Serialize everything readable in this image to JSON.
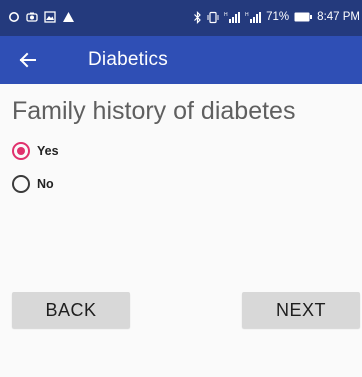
{
  "status_bar": {
    "battery_percent": "71%",
    "time": "8:47 PM",
    "icons": [
      "location-pin-icon",
      "camera-icon",
      "image-icon",
      "warning-icon",
      "bluetooth-icon",
      "vibrate-icon",
      "signal-1-icon",
      "signal-2-icon",
      "battery-icon"
    ]
  },
  "app_bar": {
    "title": "Diabetics",
    "back_icon": "back-arrow-icon"
  },
  "question": {
    "text": "Family history of diabetes"
  },
  "options": [
    {
      "label": "Yes",
      "selected": true
    },
    {
      "label": "No",
      "selected": false
    }
  ],
  "buttons": {
    "back_label": "BACK",
    "next_label": "NEXT"
  },
  "colors": {
    "status_bar": "#243a7d",
    "app_bar": "#2f4fb5",
    "accent": "#e0316d",
    "button": "#d8d8d8"
  }
}
